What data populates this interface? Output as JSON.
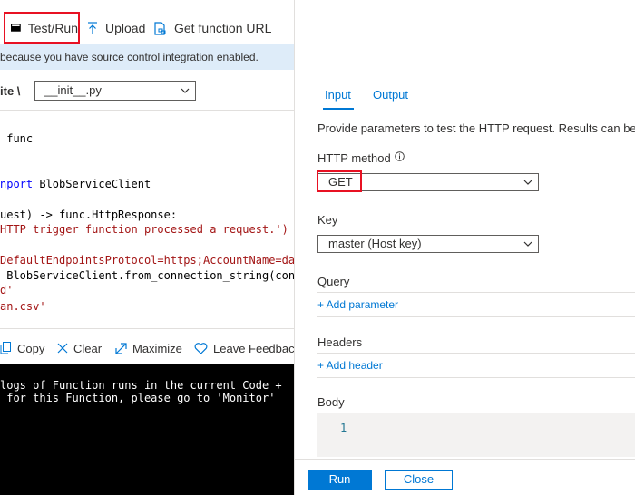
{
  "toolbar": {
    "test_run": "Test/Run",
    "upload": "Upload",
    "get_function_url": "Get function URL"
  },
  "banner": {
    "text": "because you have source control integration enabled."
  },
  "path": {
    "prefix": "ite  \\",
    "file": "__init__.py"
  },
  "code": {
    "lines": [
      {
        "text": " func",
        "cls": "plain"
      },
      {
        "text": "",
        "cls": "plain"
      },
      {
        "text": "",
        "cls": "plain"
      },
      {
        "text": "nport BlobServiceClient",
        "cls": "mixed_import"
      },
      {
        "text": "",
        "cls": "plain"
      },
      {
        "text": "uest) -> func.HttpResponse:",
        "cls": "plain"
      },
      {
        "text": "HTTP trigger function processed a request.')",
        "cls": "str"
      },
      {
        "text": "",
        "cls": "plain"
      },
      {
        "text": "DefaultEndpointsProtocol=https;AccountName=data",
        "cls": "str"
      },
      {
        "text": " BlobServiceClient.from_connection_string(conne",
        "cls": "plain"
      },
      {
        "text": "d'",
        "cls": "str"
      },
      {
        "text": "an.csv'",
        "cls": "str"
      }
    ]
  },
  "console_toolbar": {
    "copy": "Copy",
    "clear": "Clear",
    "maximize": "Maximize",
    "leave_feedback": "Leave Feedback"
  },
  "console": {
    "lines": [
      "logs of Function runs in the current Code +",
      " for this Function, please go to 'Monitor'"
    ]
  },
  "panel": {
    "tab_input": "Input",
    "tab_output": "Output",
    "description": "Provide parameters to test the HTTP request. Results can be fou",
    "http_method_label": "HTTP method",
    "http_method_value": "GET",
    "key_label": "Key",
    "key_value": "master (Host key)",
    "query_label": "Query",
    "add_parameter": "+ Add parameter",
    "headers_label": "Headers",
    "add_header": "+ Add header",
    "body_label": "Body",
    "body_line_number": "1",
    "run": "Run",
    "close": "Close"
  },
  "colors": {
    "accent": "#0078d4",
    "highlight": "#e81123",
    "banner_bg": "#deecf9",
    "keyword": "#0000ff",
    "string": "#a31515"
  }
}
